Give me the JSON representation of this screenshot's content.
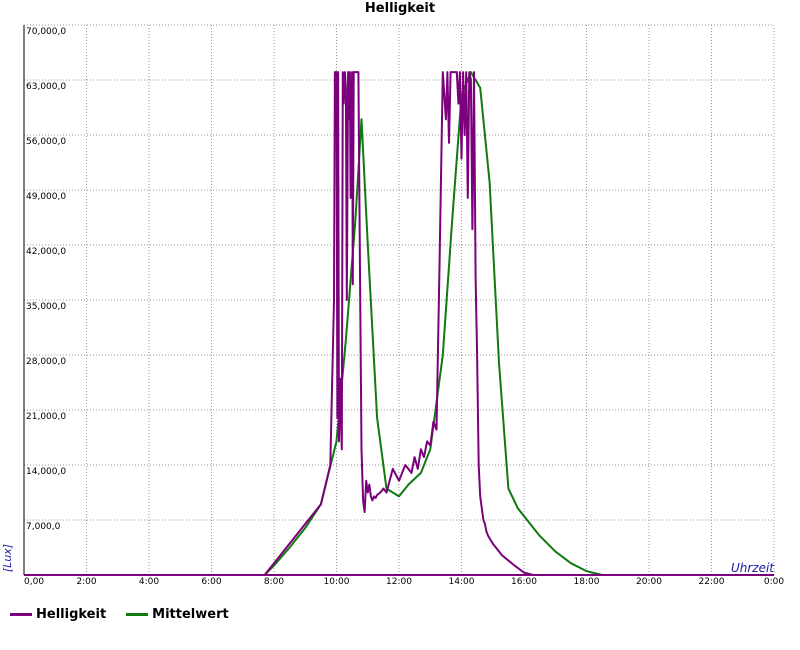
{
  "colors": {
    "helligkeit": "#7b007b",
    "mittelwert": "#107a10",
    "grid": "#999999",
    "ylabel": "#1a1aa6"
  },
  "chart_data": {
    "type": "line",
    "title": "Helligkeit",
    "xlabel": "Uhrzeit",
    "ylabel": "[Lux]",
    "xlim": [
      0,
      24
    ],
    "ylim": [
      0,
      70000
    ],
    "grid": true,
    "legend_position": "bottom-left",
    "x_ticks": [
      "0,00",
      "2:00",
      "4:00",
      "6:00",
      "8:00",
      "10:00",
      "12:00",
      "14:00",
      "16:00",
      "18:00",
      "20:00",
      "22:00",
      "0:00"
    ],
    "y_ticks": [
      "70,000,0",
      "63,000,0",
      "56,000,0",
      "49,000,0",
      "42,000,0",
      "35,000,0",
      "28,000,0",
      "21,000,0",
      "14,000,0",
      "7,000,0"
    ],
    "series": [
      {
        "name": "Helligkeit",
        "color": "#7b007b",
        "x": [
          0,
          7.7,
          8.0,
          8.5,
          9.0,
          9.5,
          9.8,
          9.92,
          9.95,
          10.0,
          10.03,
          10.05,
          10.08,
          10.12,
          10.17,
          10.2,
          10.23,
          10.27,
          10.3,
          10.33,
          10.37,
          10.4,
          10.43,
          10.45,
          10.5,
          10.52,
          10.55,
          10.58,
          10.6,
          10.65,
          10.7,
          10.75,
          10.8,
          10.85,
          10.9,
          10.95,
          11.0,
          11.05,
          11.1,
          11.15,
          11.2,
          11.25,
          11.3,
          11.4,
          11.5,
          11.6,
          11.8,
          12.0,
          12.2,
          12.4,
          12.5,
          12.6,
          12.7,
          12.8,
          12.9,
          13.0,
          13.1,
          13.2,
          13.3,
          13.4,
          13.5,
          13.55,
          13.6,
          13.65,
          13.7,
          13.75,
          13.8,
          13.85,
          13.9,
          13.95,
          14.0,
          14.05,
          14.1,
          14.15,
          14.2,
          14.25,
          14.3,
          14.35,
          14.4,
          14.45,
          14.5,
          14.55,
          14.6,
          14.65,
          14.7,
          14.75,
          14.8,
          14.85,
          15.0,
          15.3,
          15.7,
          16.0,
          16.3,
          16.6,
          17.0,
          17.5,
          18.0,
          18.5,
          24
        ],
        "values": [
          0,
          0,
          1500,
          4000,
          6500,
          9000,
          14000,
          35000,
          64000,
          64000,
          20000,
          64000,
          17000,
          25000,
          16000,
          64000,
          60000,
          64000,
          62000,
          35000,
          64000,
          58000,
          64000,
          48000,
          64000,
          37000,
          64000,
          64000,
          64000,
          64000,
          64000,
          40000,
          16000,
          9500,
          8000,
          12000,
          10500,
          11500,
          10000,
          9500,
          10000,
          9800,
          10200,
          10500,
          11000,
          10500,
          13500,
          12000,
          14000,
          13000,
          15000,
          13500,
          16000,
          15000,
          17000,
          16500,
          19500,
          18500,
          40000,
          64000,
          58000,
          64000,
          55000,
          64000,
          64000,
          64000,
          64000,
          64000,
          60000,
          64000,
          53000,
          64000,
          56000,
          64000,
          48000,
          64000,
          63000,
          44000,
          64000,
          38000,
          28000,
          14000,
          10000,
          8500,
          7000,
          6500,
          5500,
          5000,
          4000,
          2500,
          1200,
          300,
          0,
          0,
          0,
          0,
          0,
          0,
          0
        ]
      },
      {
        "name": "Mittelwert",
        "color": "#107a10",
        "x": [
          0,
          7.7,
          8.0,
          8.5,
          9.0,
          9.5,
          10.0,
          10.3,
          10.6,
          10.8,
          11.0,
          11.3,
          11.6,
          12.0,
          12.3,
          12.7,
          13.0,
          13.4,
          13.7,
          14.0,
          14.3,
          14.6,
          14.9,
          15.2,
          15.5,
          15.8,
          16.1,
          16.5,
          17.0,
          17.5,
          18.0,
          18.5,
          24
        ],
        "values": [
          0,
          0,
          1200,
          3500,
          6000,
          9000,
          17000,
          30000,
          45000,
          58000,
          42000,
          20000,
          11000,
          10000,
          11500,
          13000,
          16000,
          28000,
          45000,
          61000,
          64000,
          62000,
          50000,
          27000,
          11000,
          8500,
          7000,
          5000,
          3000,
          1500,
          500,
          0,
          0
        ]
      }
    ]
  }
}
